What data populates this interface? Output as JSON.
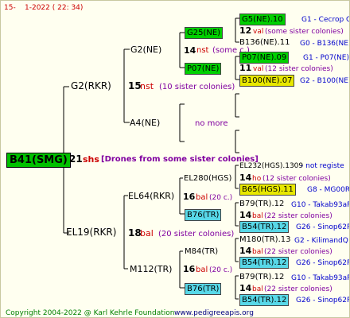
{
  "header": {
    "id": "15-",
    "date": "1-2022 ( 22: 34)"
  },
  "footer": {
    "copyright": "Copyright 2004-2022 @ Karl Kehrle Foundation",
    "site": "www.pedigreeapis.org"
  },
  "colors": {
    "green": "#00d000",
    "yellow": "#e8e800",
    "cyan": "#58d8e8",
    "background": "#fffff0"
  },
  "root": {
    "label": "B41(SMG)",
    "count": "21",
    "unit": "shs",
    "note": "[Drones from some sister colonies]"
  },
  "g2rkr": {
    "label": "G2(RKR)",
    "count": "15",
    "unit": "nst",
    "note": "(10 sister colonies)",
    "g2ne": {
      "label": "G2(NE)",
      "g25": {
        "label": "G25(NE)",
        "count": "14",
        "unit": "nst",
        "note": "(some c.)"
      },
      "p07": {
        "label": "P07(NE)",
        "count": "11",
        "unit": "val",
        "note": "(12 sister colonies)"
      }
    },
    "a4": {
      "label": "A4(NE)",
      "note": "no more"
    },
    "r1": {
      "label": "G5(NE).10",
      "code": "G1 - Cecrop Q",
      "count": "12",
      "unit": "val",
      "note": "(some sister colonies)"
    },
    "r2": {
      "label": "B136(NE).11",
      "code": "G0 - B136(NE)"
    },
    "r3": {
      "label": "P07(NE).09",
      "code": "G1 - P07(NE)",
      "count": "11",
      "unit": "val",
      "note": "(12 sister colonies)"
    },
    "r4": {
      "label": "B100(NE).07",
      "code": "G2 - B100(NE)"
    }
  },
  "el19": {
    "label": "EL19(RKR)",
    "count": "18",
    "unit": "bal",
    "note": "(20 sister colonies)",
    "el64": {
      "label": "EL64(RKR)",
      "count": "16",
      "unit": "bal",
      "note": "(20 c.)",
      "el280": {
        "label": "EL280(HGS)",
        "count": "14",
        "unit": "ho",
        "note": "(12 sister colonies)"
      },
      "b76": {
        "label": "B76(TR)",
        "count": "14",
        "unit": "bal",
        "note": "(22 sister colonies)"
      }
    },
    "m112": {
      "label": "M112(TR)",
      "count": "16",
      "unit": "bal",
      "note": "(20 c.)",
      "m84": {
        "label": "M84(TR)",
        "count": "14",
        "unit": "bal",
        "note": "(22 sister colonies)"
      },
      "b76": {
        "label": "B76(TR)",
        "count": "14",
        "unit": "bal",
        "note": "(22 sister colonies)"
      }
    },
    "r1": {
      "label": "EL232(HGS).1309",
      "code": "- not registe"
    },
    "r2": {
      "label": "B65(HGS).11",
      "code": "G8 - MG00R"
    },
    "r3": {
      "label": "B79(TR).12",
      "code": "G10 - Takab93aR"
    },
    "r4": {
      "label": "B54(TR).12",
      "code": "G26 - Sinop62R"
    },
    "r5": {
      "label": "M180(TR).13",
      "code": "G2 - KilimandQ"
    },
    "r6": {
      "label": "B54(TR).12",
      "code": "G26 - Sinop62R"
    },
    "r7": {
      "label": "B79(TR).12",
      "code": "G10 - Takab93aR"
    },
    "r8": {
      "label": "B54(TR).12",
      "code": "G26 - Sinop62R"
    }
  }
}
